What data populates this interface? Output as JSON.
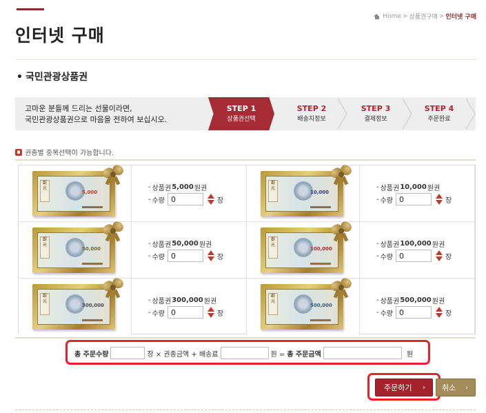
{
  "breadcrumb": {
    "home": "Home",
    "sep": ">",
    "parent": "상품권구매",
    "current": "인터넷 구매"
  },
  "page": {
    "title": "인터넷 구매",
    "section": "국민관광상품권"
  },
  "intro": {
    "line1": "고마운 분들께 드리는 선물이라면,",
    "line2": "국민관광상품권으로 마음을 전하여 보십시오."
  },
  "steps": [
    {
      "num": "STEP 1",
      "name": "상품권선택",
      "active": true
    },
    {
      "num": "STEP 2",
      "name": "배송지정보",
      "active": false
    },
    {
      "num": "STEP 3",
      "name": "결제정보",
      "active": false
    },
    {
      "num": "STEP 4",
      "name": "주문완료",
      "active": false
    }
  ],
  "notice": "권종별 중복선택이 가능합니다.",
  "products": [
    {
      "prefix": "상품권",
      "amount": "5,000",
      "suffix": "원권",
      "qty_label": "수량",
      "qty": "0",
      "unit": "장",
      "face": "5,000",
      "face_color": "#c0392b"
    },
    {
      "prefix": "상품권",
      "amount": "10,000",
      "suffix": "원권",
      "qty_label": "수량",
      "qty": "0",
      "unit": "장",
      "face": "10,000",
      "face_color": "#2c3e7a"
    },
    {
      "prefix": "상품권",
      "amount": "50,000",
      "suffix": "원권",
      "qty_label": "수량",
      "qty": "0",
      "unit": "장",
      "face": "50,000",
      "face_color": "#6b6b2a"
    },
    {
      "prefix": "상품권",
      "amount": "100,000",
      "suffix": "원권",
      "qty_label": "수량",
      "qty": "0",
      "unit": "장",
      "face": "100,000",
      "face_color": "#b03030"
    },
    {
      "prefix": "상품권",
      "amount": "300,000",
      "suffix": "원권",
      "qty_label": "수량",
      "qty": "0",
      "unit": "장",
      "face": "300,000",
      "face_color": "#4a4a4a"
    },
    {
      "prefix": "상품권",
      "amount": "500,000",
      "suffix": "원권",
      "qty_label": "수량",
      "qty": "0",
      "unit": "장",
      "face": "500,000",
      "face_color": "#3a5a7a"
    }
  ],
  "summary": {
    "total_qty_label": "총 주문수량",
    "formula": "장 × 권종금액 + 배송료",
    "equals": "원 =",
    "total_amount_label": "총 주문금액",
    "won": "원"
  },
  "buttons": {
    "order": "주문하기",
    "cancel": "취소"
  },
  "colors": {
    "brand": "#a3222b",
    "highlight": "#e8202a",
    "cancel": "#a38b5a"
  }
}
